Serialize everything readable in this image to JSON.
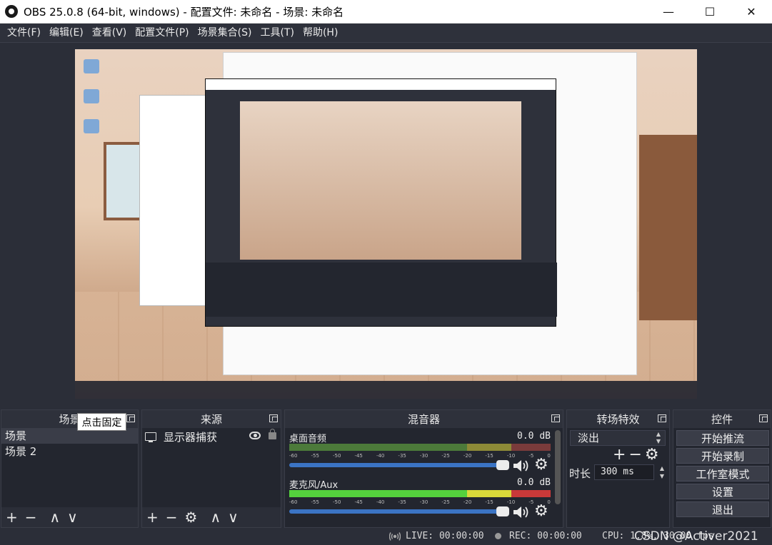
{
  "window": {
    "title": "OBS 25.0.8 (64-bit, windows) - 配置文件: 未命名 - 场景: 未命名",
    "minimize": "—",
    "maximize": "☐",
    "close": "✕"
  },
  "menu": [
    "文件(F)",
    "编辑(E)",
    "查看(V)",
    "配置文件(P)",
    "场景集合(S)",
    "工具(T)",
    "帮助(H)"
  ],
  "scenes": {
    "header": "场景",
    "tooltip": "点击固定",
    "items": [
      "场景",
      "场景 2"
    ]
  },
  "sources": {
    "header": "来源",
    "items": [
      "显示器捕获"
    ]
  },
  "mixer": {
    "header": "混音器",
    "scale": [
      "-60",
      "-55",
      "-50",
      "-45",
      "-40",
      "-35",
      "-30",
      "-25",
      "-20",
      "-15",
      "-10",
      "-5",
      "0"
    ],
    "channels": [
      {
        "name": "桌面音频",
        "db": "0.0 dB"
      },
      {
        "name": "麦克风/Aux",
        "db": "0.0 dB"
      }
    ]
  },
  "transitions": {
    "header": "转场特效",
    "selected": "淡出",
    "duration_label": "时长",
    "duration_value": "300 ms"
  },
  "controls": {
    "header": "控件",
    "buttons": [
      "开始推流",
      "开始录制",
      "工作室模式",
      "设置",
      "退出"
    ]
  },
  "status": {
    "live": "LIVE: 00:00:00",
    "rec": "REC: 00:00:00",
    "cpu": "CPU: 1.8%, 30.00 fps",
    "watermark": "CSDN @Activer2021"
  },
  "icons": {
    "add": "+",
    "remove": "−",
    "up": "∧",
    "down": "∨",
    "gear": "⚙"
  }
}
